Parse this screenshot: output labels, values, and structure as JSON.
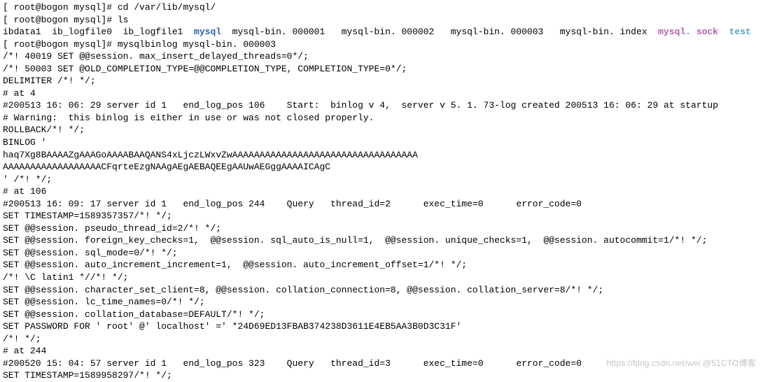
{
  "term": {
    "prompt1": "[ root@bogon mysql]# ",
    "cmd1": "cd /var/lib/mysql/",
    "prompt2": "[ root@bogon mysql]# ",
    "cmd2": "ls",
    "ls_pre": "ibdata1  ib_logfile0  ib_logfile1  ",
    "ls_mysql": "mysql",
    "ls_mid": "  mysql-bin. 000001   mysql-bin. 000002   mysql-bin. 000003   mysql-bin. index  ",
    "ls_sock": "mysql. sock",
    "ls_gap": "  ",
    "ls_test": "test",
    "prompt3": "[ root@bogon mysql]# ",
    "cmd3": "mysqlbinlog mysql-bin. 000003",
    "l4": "/*! 40019 SET @@session. max_insert_delayed_threads=0*/;",
    "l5": "/*! 50003 SET @OLD_COMPLETION_TYPE=@@COMPLETION_TYPE, COMPLETION_TYPE=0*/;",
    "l6": "DELIMITER /*! */;",
    "l7": "# at 4",
    "l8": "#200513 16: 06: 29 server id 1   end_log_pos 106    Start:  binlog v 4,  server v 5. 1. 73-log created 200513 16: 06: 29 at startup",
    "l9": "# Warning:  this binlog is either in use or was not closed properly.",
    "l10": "ROLLBACK/*! */;",
    "l11": "BINLOG '",
    "l12": "haq7Xg8BAAAAZgAAAGoAAAABAAQANS4xLjczLWxvZwAAAAAAAAAAAAAAAAAAAAAAAAAAAAAAAAAA",
    "l13": "AAAAAAAAAAAAAAAAAACFqrteEzgNAAgAEgAEBAQEEgAAUwAEGggAAAAICAgC",
    "l14": "' /*! */;",
    "l15": "# at 106",
    "l16": "#200513 16: 09: 17 server id 1   end_log_pos 244    Query   thread_id=2      exec_time=0      error_code=0",
    "l17": "SET TIMESTAMP=1589357357/*! */;",
    "l18": "SET @@session. pseudo_thread_id=2/*! */;",
    "l19": "SET @@session. foreign_key_checks=1,  @@session. sql_auto_is_null=1,  @@session. unique_checks=1,  @@session. autocommit=1/*! */;",
    "l20": "SET @@session. sql_mode=0/*! */;",
    "l21": "SET @@session. auto_increment_increment=1,  @@session. auto_increment_offset=1/*! */;",
    "l22": "/*! \\C latin1 *//*! */;",
    "l23": "SET @@session. character_set_client=8, @@session. collation_connection=8, @@session. collation_server=8/*! */;",
    "l24": "SET @@session. lc_time_names=0/*! */;",
    "l25": "SET @@session. collation_database=DEFAULT/*! */;",
    "l26": "SET PASSWORD FOR ' root' @' localhost' =' *24D69ED13FBAB374238D3611E4EB5AA3B0D3C31F'",
    "l27": "/*! */;",
    "l28": "# at 244",
    "l29": "#200520 15: 04: 57 server id 1   end_log_pos 323    Query   thread_id=3      exec_time=0      error_code=0",
    "l30": "SET TIMESTAMP=1589958297/*! */;"
  },
  "watermark": "https://blog.csdn.net/wei @51CTO博客"
}
